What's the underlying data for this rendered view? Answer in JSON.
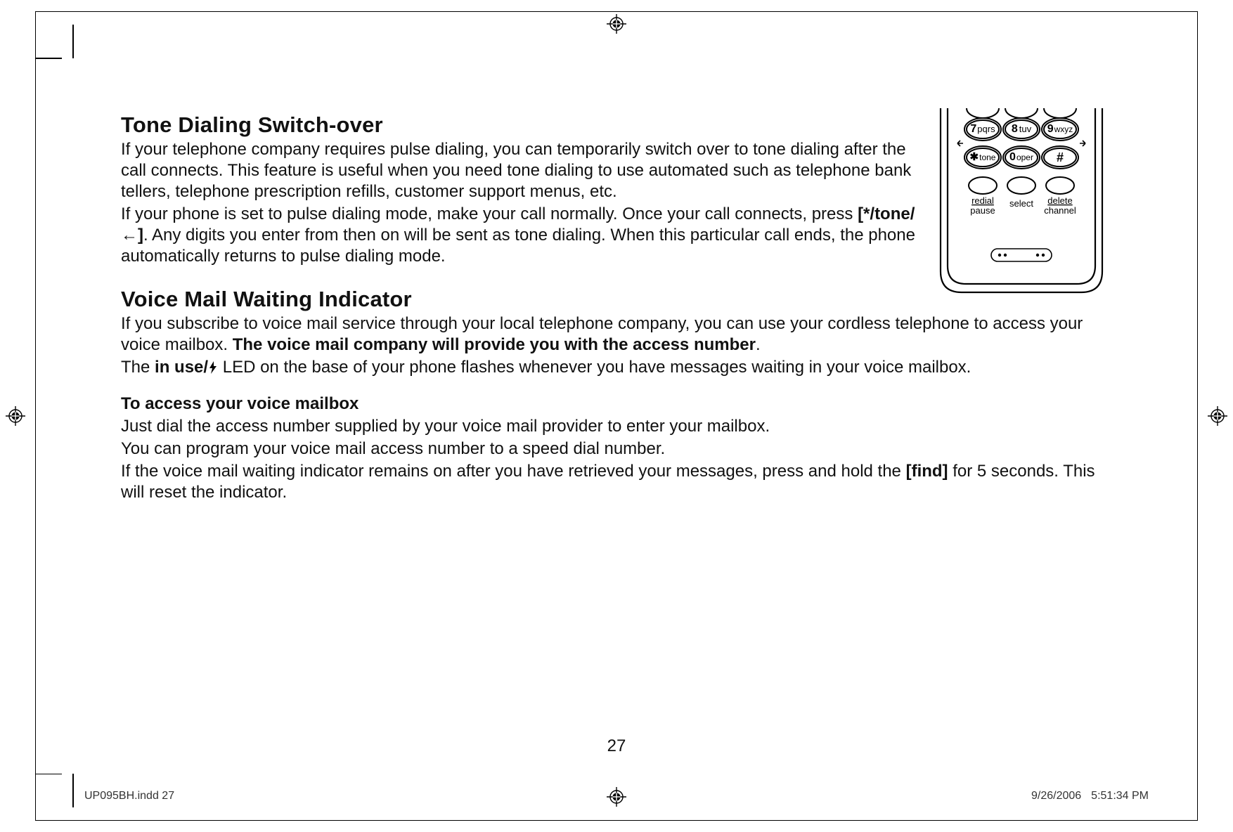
{
  "section1": {
    "title": "Tone Dialing Switch-over",
    "p1": "If your telephone company requires pulse dialing, you can temporarily switch over to tone dialing after the call connects. This feature is useful when you need tone dialing to use automated such as telephone bank tellers, telephone prescription refills, customer support menus, etc.",
    "p2a": "If your phone is set to pulse dialing mode, make your call normally. Once your call connects, press ",
    "p2_key": "[*/tone/←]",
    "p2b": ". Any digits you enter from then on will be sent as tone dialing. When this particular call ends, the phone automatically returns to pulse dialing mode."
  },
  "section2": {
    "title": "Voice Mail Waiting Indicator",
    "p1a": "If you subscribe to voice mail service through your local telephone company, you can use your cordless telephone to access your voice mailbox. ",
    "p1_bold": "The voice mail company will provide you with the access number",
    "p1b": ".",
    "p2a": "The ",
    "p2_bold": "in use/",
    "p2b": " LED on the base of your phone flashes whenever you have messages waiting in your voice mailbox.",
    "subhead": "To access your voice mailbox",
    "p3": "Just dial the access number supplied by your voice mail provider to enter your mailbox.",
    "p4": "You can program your voice mail access number to a speed dial number.",
    "p5a": "If the voice mail waiting indicator remains on after you have retrieved your messages, press and hold the ",
    "p5_key": "[find]",
    "p5b": " for 5 seconds. This will reset the indicator."
  },
  "page_number": "27",
  "footer": {
    "file": "UP095BH.indd   27",
    "date": "9/26/2006",
    "time": "5:51:34 PM"
  },
  "phone": {
    "keys": {
      "k7": "7pqrs",
      "k8": "8 tuv",
      "k9": "9wxyz",
      "kstar": "✱tone",
      "k0": "0oper",
      "khash": "#"
    },
    "labels": {
      "redial": "redial",
      "pause": "pause",
      "select": "select",
      "delete": "delete",
      "channel": "channel"
    }
  }
}
